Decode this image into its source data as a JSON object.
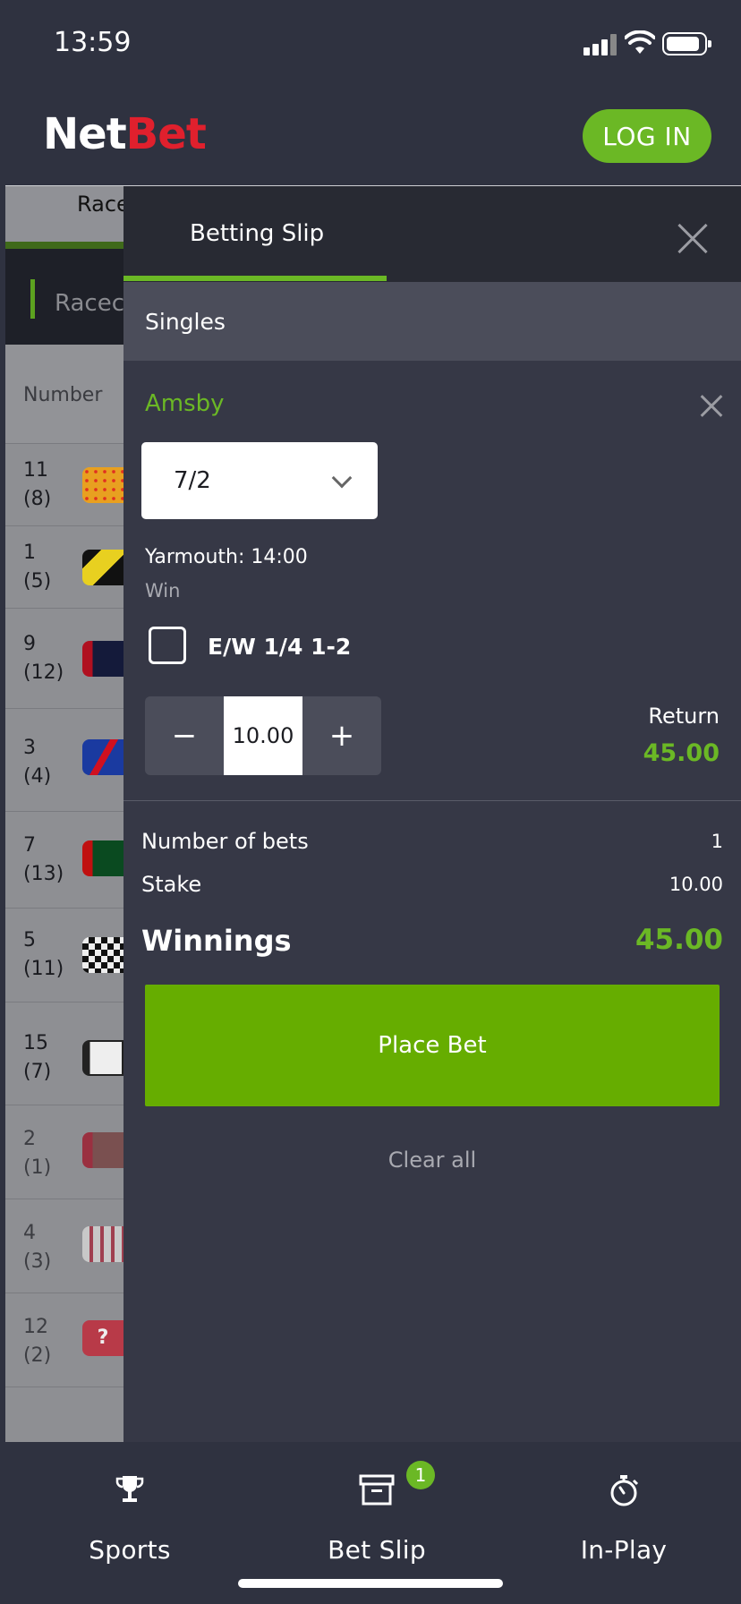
{
  "status_bar": {
    "time": "13:59"
  },
  "header": {
    "logo_left": "Net",
    "logo_right": "Bet",
    "login_label": "LOG IN"
  },
  "background_page": {
    "tab_label": "Race",
    "race_header": "Racec",
    "column_header": "Number",
    "runners": [
      {
        "number": "11\n(8)",
        "silk": "orange-yellow-spots"
      },
      {
        "number": "1\n(5)",
        "silk": "yellow-black-chevron"
      },
      {
        "number": "9\n(12)",
        "silk": "navy-red"
      },
      {
        "number": "3\n(4)",
        "silk": "blue-red-sash"
      },
      {
        "number": "7\n(13)",
        "silk": "green-red"
      },
      {
        "number": "5\n(11)",
        "silk": "black-white-check"
      },
      {
        "number": "15\n(7)",
        "silk": "white-black"
      },
      {
        "number": "2\n(1)",
        "silk": "maroon"
      },
      {
        "number": "4\n(3)",
        "silk": "white-red-stripes"
      },
      {
        "number": "12\n(2)",
        "silk": "red-question"
      }
    ]
  },
  "slip": {
    "title": "Betting Slip",
    "section": "Singles",
    "selection": {
      "name": "Amsby",
      "odds": "7/2",
      "venue": "Yarmouth: 14:00",
      "market": "Win",
      "each_way_label": "E/W 1/4 1-2",
      "each_way_checked": false,
      "stake": "10.00",
      "minus": "−",
      "plus": "+",
      "return_label": "Return",
      "return_value": "45.00"
    },
    "summary": {
      "bets_label": "Number of bets",
      "bets_value": "1",
      "stake_label": "Stake",
      "stake_value": "10.00",
      "winnings_label": "Winnings",
      "winnings_value": "45.00"
    },
    "place_bet_label": "Place Bet",
    "clear_label": "Clear all"
  },
  "bottom_nav": {
    "items": [
      {
        "label": "Sports",
        "icon": "trophy-icon"
      },
      {
        "label": "Bet Slip",
        "icon": "archive-box-icon"
      },
      {
        "label": "In-Play",
        "icon": "stopwatch-icon"
      }
    ],
    "bet_slip_badge": "1"
  },
  "colors": {
    "accent_green": "#6bb825",
    "place_bet_green": "#66ad00",
    "logo_red": "#e0202d",
    "panel_bg": "#363846"
  }
}
